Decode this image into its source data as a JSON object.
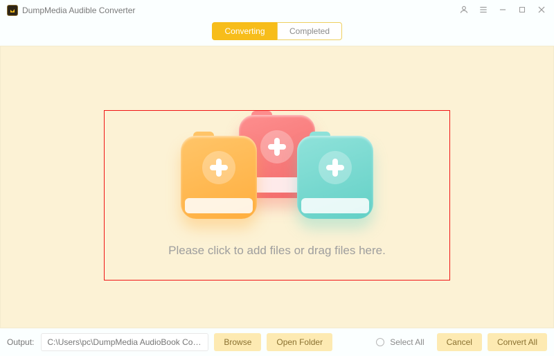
{
  "app": {
    "title": "DumpMedia Audible Converter"
  },
  "tabs": {
    "converting": "Converting",
    "completed": "Completed"
  },
  "dropzone": {
    "hint": "Please click to add files or drag files here."
  },
  "bottom": {
    "output_label": "Output:",
    "output_path": "C:\\Users\\pc\\DumpMedia AudioBook Converte",
    "browse": "Browse",
    "open_folder": "Open Folder",
    "select_all": "Select All",
    "cancel": "Cancel",
    "convert_all": "Convert All"
  }
}
